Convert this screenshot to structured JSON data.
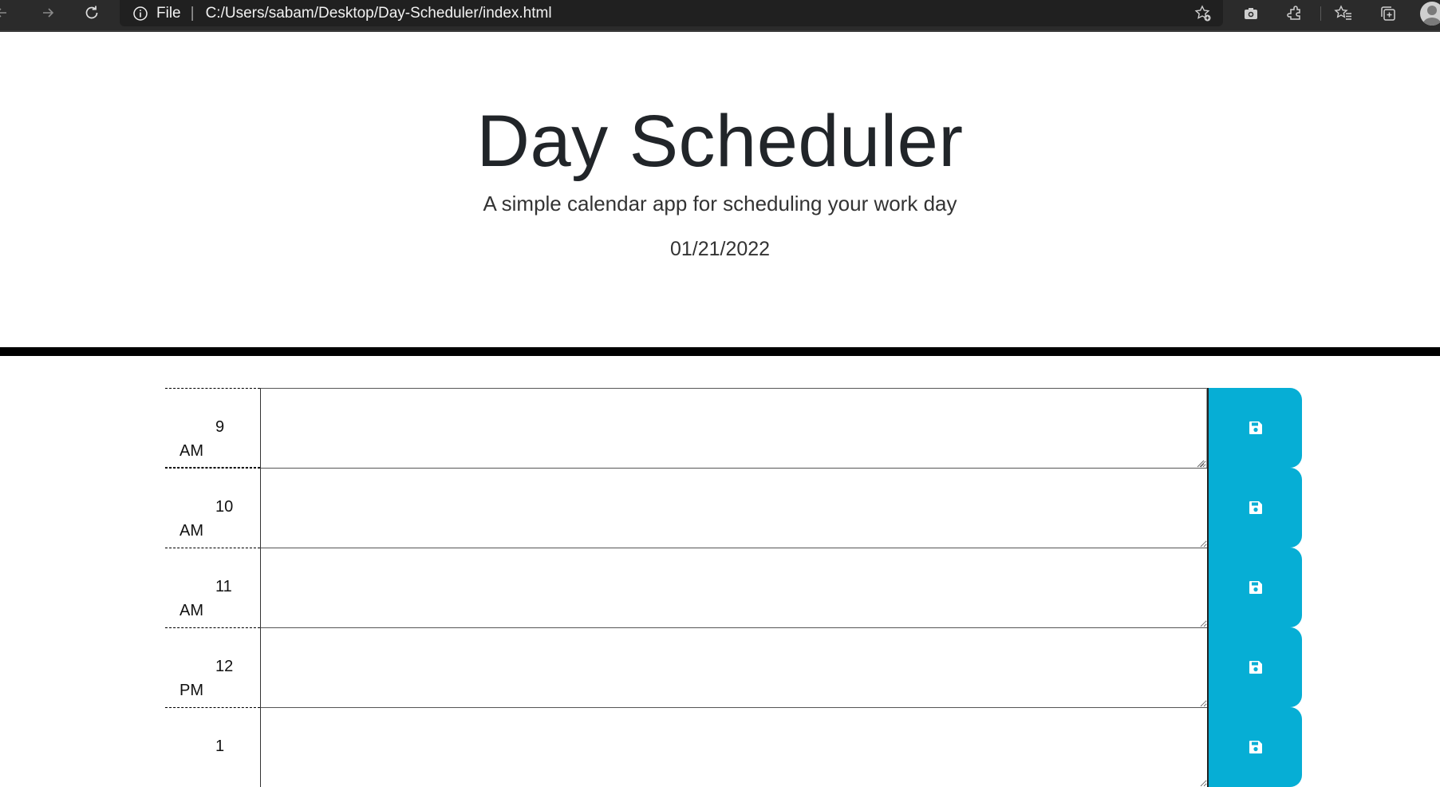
{
  "browser": {
    "protocol_label": "File",
    "separator": "|",
    "url": "C:/Users/sabam/Desktop/Day-Scheduler/index.html"
  },
  "header": {
    "title": "Day Scheduler",
    "lead": "A simple calendar app for scheduling your work day",
    "current_day": "01/21/2022"
  },
  "time_blocks": [
    {
      "hour": "9",
      "period": "AM",
      "text": ""
    },
    {
      "hour": "10",
      "period": "AM",
      "text": ""
    },
    {
      "hour": "11",
      "period": "AM",
      "text": ""
    },
    {
      "hour": "12",
      "period": "PM",
      "text": ""
    },
    {
      "hour": "1",
      "period": "",
      "text": ""
    }
  ],
  "colors": {
    "save_button": "#06aed5",
    "header_rule": "#000000"
  }
}
